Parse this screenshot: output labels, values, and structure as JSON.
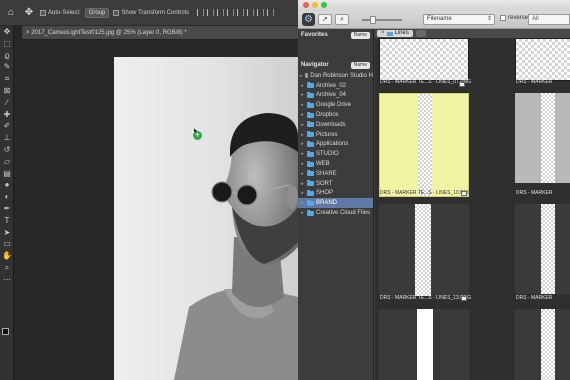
{
  "photoshop": {
    "options_bar": {
      "auto_select_label": "Auto-Select:",
      "auto_select_mode": "Group",
      "show_transform_label": "Show Transform Controls"
    },
    "document_tab": "2017_CameoLightTest0125.jpg @ 25% (Layer 0, RGB/8) *",
    "close_glyph": "×"
  },
  "finder": {
    "window_title": "Lines",
    "toolbar": {
      "sort_value": "Filename",
      "reverse_label": "reverse",
      "filter_value": "All"
    },
    "sidebar": {
      "favorites_label": "Favorites",
      "navigator_label": "Navigator",
      "name_button_label": "Name",
      "items": [
        {
          "label": "Dan Robinson Studio H",
          "type": "disk",
          "selected": false
        },
        {
          "label": "Archive_02",
          "type": "folder",
          "selected": false
        },
        {
          "label": "Archive_04",
          "type": "folder",
          "selected": false
        },
        {
          "label": "Google Drive",
          "type": "folder",
          "selected": false
        },
        {
          "label": "Dropbox",
          "type": "folder",
          "selected": false
        },
        {
          "label": "Downloads",
          "type": "folder",
          "selected": false
        },
        {
          "label": "Pictures",
          "type": "folder",
          "selected": false
        },
        {
          "label": "Applications",
          "type": "folder",
          "selected": false
        },
        {
          "label": "STUDIO",
          "type": "folder",
          "selected": false
        },
        {
          "label": "WEB",
          "type": "folder",
          "selected": false
        },
        {
          "label": "SHARE",
          "type": "folder",
          "selected": false
        },
        {
          "label": "SORT",
          "type": "folder",
          "selected": false
        },
        {
          "label": "SHOP",
          "type": "folder",
          "selected": false
        },
        {
          "label": "BRAND",
          "type": "folder",
          "selected": true
        },
        {
          "label": "Creative Cloud Files",
          "type": "folder",
          "selected": false
        }
      ]
    },
    "tab_label": "Lines",
    "thumbnails": [
      {
        "label": "DRS - MARKER TE...S - LINES_07.PNG",
        "style": "checker"
      },
      {
        "label": "DRS - MARKER TE...S - LINES_10.PNG",
        "style": "yellow"
      },
      {
        "label": "DRS - MARKER TE...S - LINES_13.PNG",
        "style": "checker"
      },
      {
        "label": "DRS - MARKER",
        "style": "checker"
      },
      {
        "label": "DRS - MARKER",
        "style": "checker"
      },
      {
        "label": "DRS - MARKER",
        "style": "checker"
      }
    ]
  }
}
